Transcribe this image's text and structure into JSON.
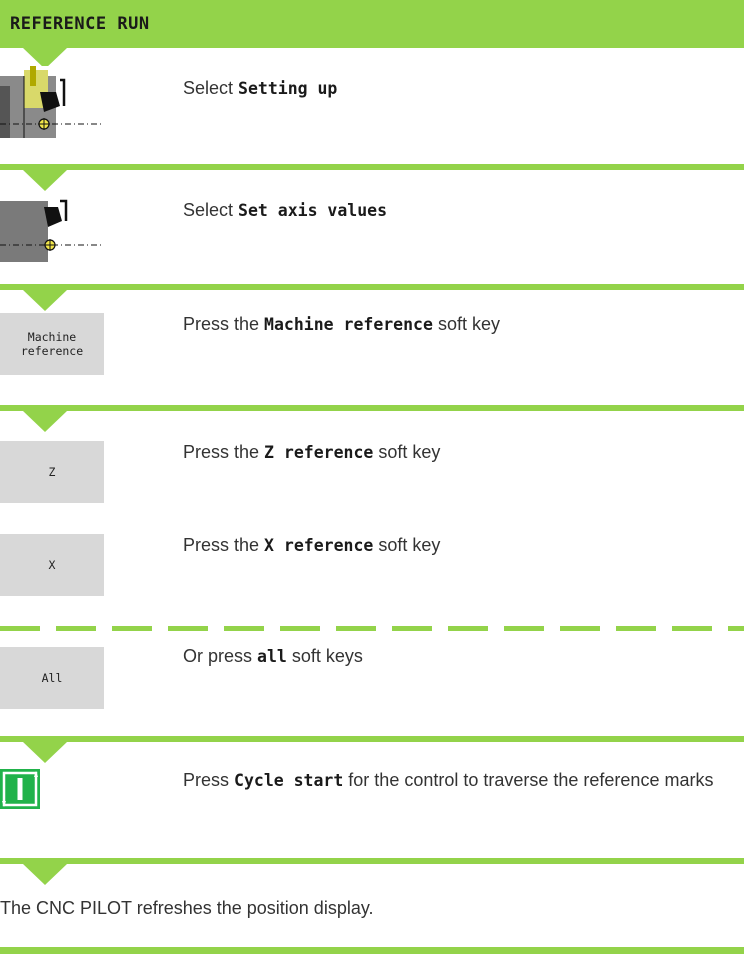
{
  "header": {
    "title": "REFERENCE RUN"
  },
  "steps": [
    {
      "pre": "Select ",
      "bold": "Setting up",
      "post": ""
    },
    {
      "pre": "Select ",
      "bold": "Set axis values",
      "post": ""
    },
    {
      "pre": "Press the ",
      "bold": "Machine reference",
      "post": " soft key"
    },
    {
      "pre": "Press the ",
      "bold": "Z reference",
      "post": " soft key"
    },
    {
      "pre": "Press the ",
      "bold": "X reference",
      "post": " soft key"
    },
    {
      "pre": "Or press ",
      "bold": "all",
      "post": " soft keys"
    },
    {
      "pre": "Press ",
      "bold": "Cycle start",
      "post": " for the control to traverse the reference marks"
    }
  ],
  "softkeys": {
    "machine_reference_line1": "Machine",
    "machine_reference_line2": "reference",
    "z": "Z",
    "x": "X",
    "all": "All"
  },
  "note": "The CNC PILOT refreshes the position display.",
  "colors": {
    "accent": "#93d34a",
    "softkey_bg": "#d8d8d8",
    "cycle_start": "#21b24a"
  }
}
